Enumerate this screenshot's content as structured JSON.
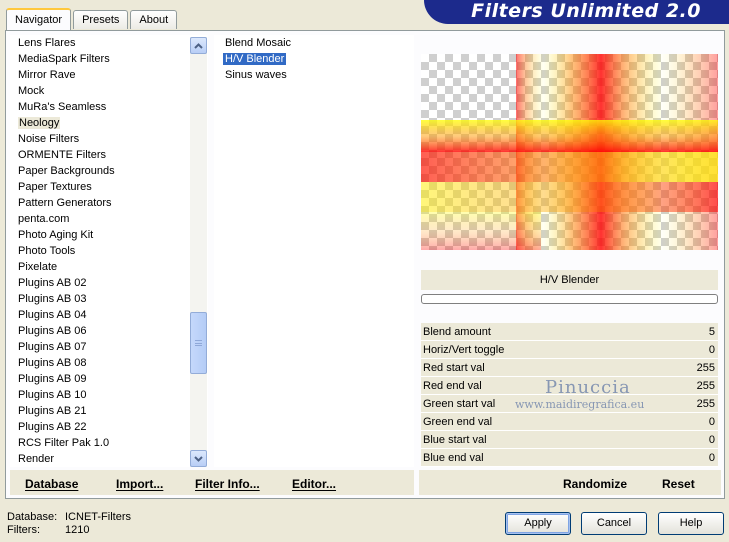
{
  "tabs": [
    {
      "label": "Navigator"
    },
    {
      "label": "Presets"
    },
    {
      "label": "About"
    }
  ],
  "banner": {
    "title": "Filters Unlimited 2.0"
  },
  "categories": {
    "items": [
      "Lens Flares",
      "MediaSpark Filters",
      "Mirror Rave",
      "Mock",
      "MuRa's Seamless",
      "Neology",
      "Noise Filters",
      "ORMENTE Filters",
      "Paper Backgrounds",
      "Paper Textures",
      "Pattern Generators",
      "penta.com",
      "Photo Aging Kit",
      "Photo Tools",
      "Pixelate",
      "Plugins AB 02",
      "Plugins AB 03",
      "Plugins AB 04",
      "Plugins AB 06",
      "Plugins AB 07",
      "Plugins AB 08",
      "Plugins AB 09",
      "Plugins AB 10",
      "Plugins AB 21",
      "Plugins AB 22",
      "RCS Filter Pak 1.0",
      "Render"
    ],
    "selected": "Neology"
  },
  "filters": {
    "items": [
      "Blend Mosaic",
      "H/V Blender",
      "Sinus waves"
    ],
    "selected": "H/V Blender"
  },
  "preview": {
    "filter_name": "H/V Blender",
    "progress": 0
  },
  "params": [
    {
      "name": "Blend amount",
      "value": "5"
    },
    {
      "name": "Horiz/Vert toggle",
      "value": "0"
    },
    {
      "name": "Red start val",
      "value": "255"
    },
    {
      "name": "Red end val",
      "value": "255"
    },
    {
      "name": "Green start val",
      "value": "255"
    },
    {
      "name": "Green end val",
      "value": "0"
    },
    {
      "name": "Blue start val",
      "value": "0"
    },
    {
      "name": "Blue end val",
      "value": "0"
    }
  ],
  "watermark": {
    "name": "Pinuccia",
    "url": "www.maidiregrafica.eu"
  },
  "left_toolbar": {
    "database": "Database",
    "import": "Import...",
    "filter_info": "Filter Info...",
    "editor": "Editor..."
  },
  "right_toolbar": {
    "randomize": "Randomize",
    "reset": "Reset"
  },
  "status": {
    "database_label": "Database:",
    "database_value": "ICNET-Filters",
    "filters_label": "Filters:",
    "filters_value": "1210"
  },
  "buttons": {
    "apply": "Apply",
    "cancel": "Cancel",
    "help": "Help"
  },
  "colors": {
    "banner": "#1c2a8c",
    "selection": "#316ac5"
  }
}
